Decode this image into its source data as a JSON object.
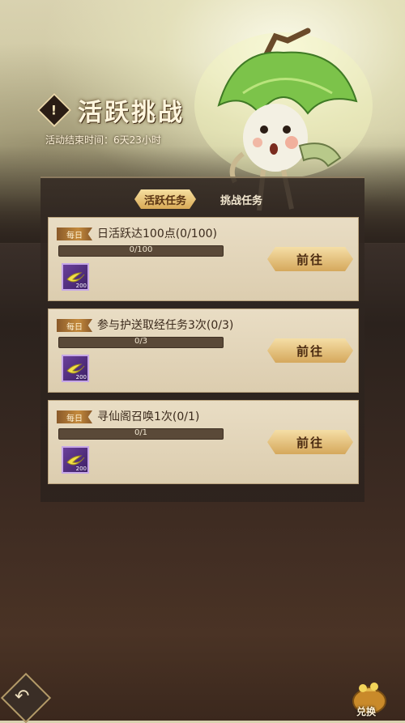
{
  "header": {
    "title": "活跃挑战",
    "info_icon": "exclamation-icon",
    "subtitle": "活动结束时间：6天23小时"
  },
  "tabs": [
    {
      "label": "活跃任务",
      "active": true
    },
    {
      "label": "挑战任务",
      "active": false
    }
  ],
  "tasks": [
    {
      "badge": "每日",
      "text": "日活跃达100点(0/100)",
      "progress_text": "0/100",
      "progress": 0.0,
      "reward_qty": "200",
      "button": "前往"
    },
    {
      "badge": "每日",
      "text": "参与护送取经任务3次(0/3)",
      "progress_text": "0/3",
      "progress": 0.0,
      "reward_qty": "200",
      "button": "前往"
    },
    {
      "badge": "每日",
      "text": "寻仙阁召唤1次(0/1)",
      "progress_text": "0/1",
      "progress": 0.0,
      "reward_qty": "200",
      "button": "前往"
    }
  ],
  "footer": {
    "back_icon": "back-arrow-icon",
    "exchange_label": "兑换",
    "exchange_icon": "money-bag-icon"
  },
  "colors": {
    "accent": "#d9aa56",
    "card_bg": "#e5d8bd",
    "reward_bg": "#5a3487"
  }
}
